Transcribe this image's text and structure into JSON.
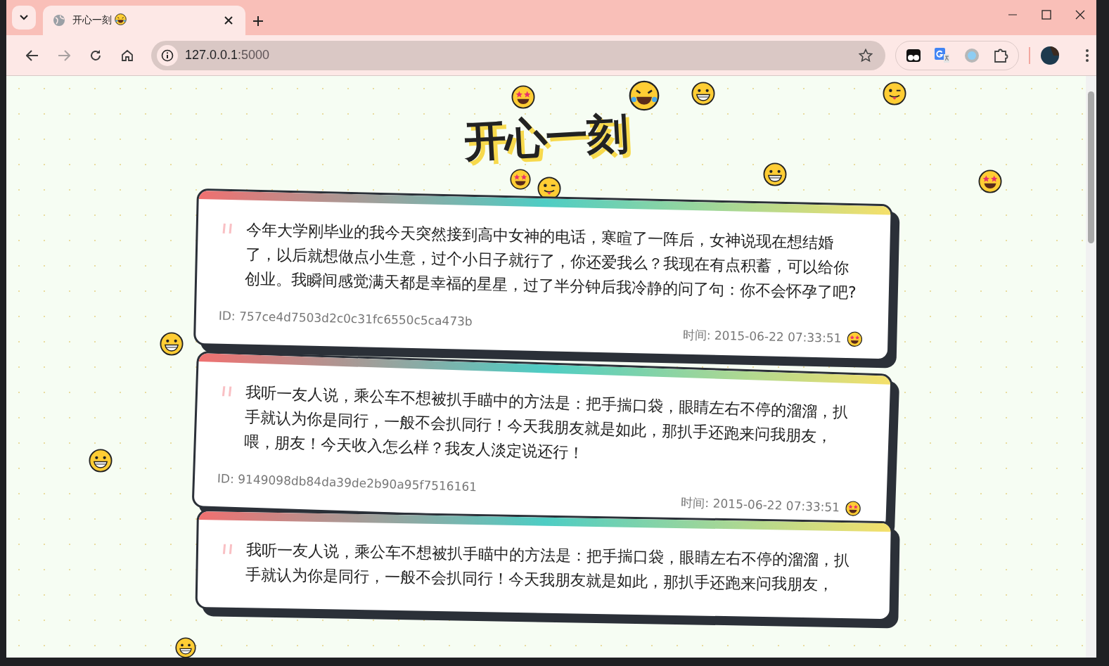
{
  "browser": {
    "tab": {
      "title": "开心一刻",
      "selected": true
    },
    "address": {
      "host": "127.0.0.1",
      "port": ":5000"
    }
  },
  "page": {
    "title": "开心一刻",
    "jokes": [
      {
        "text": "今年大学刚毕业的我今天突然接到高中女神的电话，寒暄了一阵后，女神说现在想结婚了，以后就想做点小生意，过个小日子就行了，你还爱我么？我现在有点积蓄，可以给你创业。我瞬间感觉满天都是幸福的星星，过了半分钟后我冷静的问了句：你不会怀孕了吧?",
        "id": "ID: 757ce4d7503d2c0c31fc6550c5ca473b",
        "time": "时间: 2015-06-22 07:33:51"
      },
      {
        "text": "我听一友人说，乘公车不想被扒手瞄中的方法是：把手揣口袋，眼睛左右不停的溜溜，扒手就认为你是同行，一般不会扒同行！今天我朋友就是如此，那扒手还跑来问我朋友，喂，朋友！今天收入怎么样？我友人淡定说还行！",
        "id": "ID: 9149098db84da39de2b90a95f7516161",
        "time": "时间: 2015-06-22 07:33:51"
      },
      {
        "text": "我听一友人说，乘公车不想被扒手瞄中的方法是：把手揣口袋，眼睛左右不停的溜溜，扒手就认为你是同行，一般不会扒同行！今天我朋友就是如此，那扒手还跑来问我朋友，"
      }
    ]
  }
}
